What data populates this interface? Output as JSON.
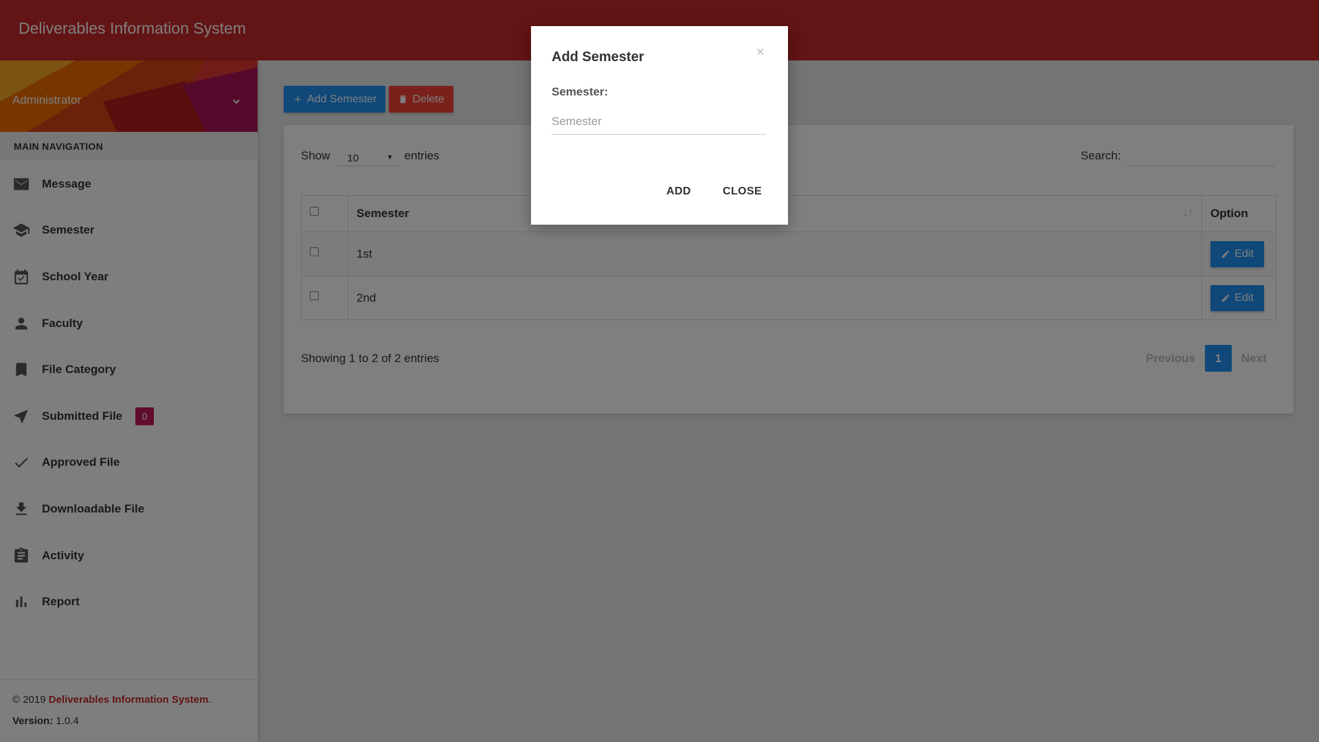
{
  "header": {
    "title": "Deliverables Information System"
  },
  "user": {
    "name": "Administrator"
  },
  "sidebar": {
    "section_title": "MAIN NAVIGATION",
    "items": [
      {
        "label": "Message",
        "icon": "envelope-icon"
      },
      {
        "label": "Semester",
        "icon": "graduation-cap-icon"
      },
      {
        "label": "School Year",
        "icon": "calendar-check-icon"
      },
      {
        "label": "Faculty",
        "icon": "person-icon"
      },
      {
        "label": "File Category",
        "icon": "bookmark-icon"
      },
      {
        "label": "Submitted File",
        "icon": "send-icon",
        "badge": "0"
      },
      {
        "label": "Approved File",
        "icon": "check-icon"
      },
      {
        "label": "Downloadable File",
        "icon": "download-icon"
      },
      {
        "label": "Activity",
        "icon": "clipboard-icon"
      },
      {
        "label": "Report",
        "icon": "bar-chart-icon"
      }
    ],
    "footer": {
      "copyright": "© 2019 ",
      "brand": "Deliverables Information System",
      "period": ".",
      "version_label": "Version:",
      "version_value": " 1.0.4"
    }
  },
  "toolbar": {
    "add_label": "Add Semester",
    "delete_label": "Delete"
  },
  "table": {
    "show_label": "Show",
    "length_value": "10",
    "entries_label": "entries",
    "search_label": "Search:",
    "columns": [
      "Semester",
      "Option"
    ],
    "rows": [
      {
        "semester": "1st",
        "option": "Edit"
      },
      {
        "semester": "2nd",
        "option": "Edit"
      }
    ],
    "info": "Showing 1 to 2 of 2 entries",
    "pagination": {
      "previous": "Previous",
      "page": "1",
      "next": "Next"
    }
  },
  "modal": {
    "title": "Add Semester",
    "close_symbol": "×",
    "field_label": "Semester:",
    "field_placeholder": "Semester",
    "field_value": "",
    "add_label": "ADD",
    "close_label": "CLOSE"
  },
  "colors": {
    "primary_red": "#c62828",
    "accent_blue": "#1f91f3",
    "delete_red": "#f44336",
    "badge_pink": "#c2185b"
  }
}
